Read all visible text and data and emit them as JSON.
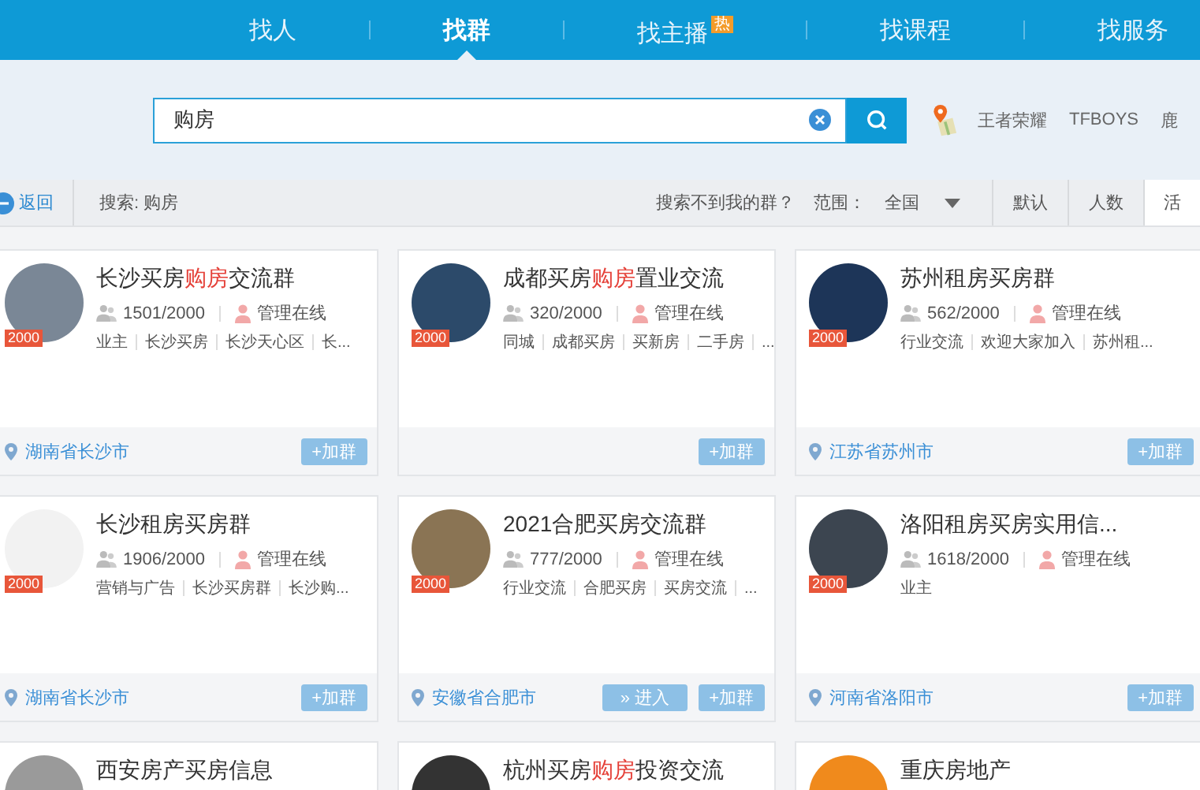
{
  "nav": {
    "tabs": [
      {
        "label": "找人",
        "selected": false
      },
      {
        "label": "找群",
        "selected": true
      },
      {
        "label": "找主播",
        "selected": false,
        "badge": "热"
      },
      {
        "label": "找课程",
        "selected": false
      },
      {
        "label": "找服务",
        "selected": false
      }
    ]
  },
  "search": {
    "value": "购房",
    "hot_keywords": [
      "王者荣耀",
      "TFBOYS",
      "鹿"
    ]
  },
  "filter_bar": {
    "back": "返回",
    "query": "搜索: 购房",
    "help_link": "搜索不到我的群？",
    "range_label": "范围：",
    "range_value": "全国",
    "sort_tabs": [
      {
        "label": "默认",
        "selected": false
      },
      {
        "label": "人数",
        "selected": false
      },
      {
        "label": "活",
        "selected": true
      }
    ]
  },
  "groups": [
    {
      "title": [
        {
          "text": "长沙买房",
          "highlight": false
        },
        {
          "text": "购房",
          "highlight": true
        },
        {
          "text": "交流群",
          "highlight": false
        }
      ],
      "badge": "2000",
      "members": "1501/2000",
      "admin": "管理在线",
      "tags": [
        "业主",
        "长沙买房",
        "长沙天心区",
        "长..."
      ],
      "location": "湖南省长沙市",
      "buttons": [
        {
          "kind": "join",
          "label": "+加群"
        }
      ]
    },
    {
      "title": [
        {
          "text": "成都买房",
          "highlight": false
        },
        {
          "text": "购房",
          "highlight": true
        },
        {
          "text": "置业交流",
          "highlight": false
        }
      ],
      "badge": "2000",
      "members": "320/2000",
      "admin": "管理在线",
      "tags": [
        "同城",
        "成都买房",
        "买新房",
        "二手房",
        "..."
      ],
      "buttons": [
        {
          "kind": "join",
          "label": "+加群"
        }
      ]
    },
    {
      "title": [
        {
          "text": "苏州租房买房群",
          "highlight": false
        }
      ],
      "badge": "2000",
      "members": "562/2000",
      "admin": "管理在线",
      "tags": [
        "行业交流",
        "欢迎大家加入",
        "苏州租..."
      ],
      "location": "江苏省苏州市",
      "buttons": [
        {
          "kind": "join",
          "label": "+加群"
        }
      ]
    },
    {
      "title": [
        {
          "text": "长沙租房买房群",
          "highlight": false
        }
      ],
      "badge": "2000",
      "members": "1906/2000",
      "admin": "管理在线",
      "tags": [
        "营销与广告",
        "长沙买房群",
        "长沙购..."
      ],
      "location": "湖南省长沙市",
      "buttons": [
        {
          "kind": "join",
          "label": "+加群"
        }
      ]
    },
    {
      "title": [
        {
          "text": "2021合肥买房交流群",
          "highlight": false
        }
      ],
      "badge": "2000",
      "members": "777/2000",
      "admin": "管理在线",
      "tags": [
        "行业交流",
        "合肥买房",
        "买房交流",
        "..."
      ],
      "location": "安徽省合肥市",
      "buttons": [
        {
          "kind": "enter",
          "label": "» 进入"
        },
        {
          "kind": "join",
          "label": "+加群"
        }
      ]
    },
    {
      "title": [
        {
          "text": "洛阳租房买房实用信...",
          "highlight": false
        }
      ],
      "badge": "2000",
      "members": "1618/2000",
      "admin": "管理在线",
      "tags": [
        "业主"
      ],
      "location": "河南省洛阳市",
      "buttons": [
        {
          "kind": "join",
          "label": "+加群"
        }
      ]
    },
    {
      "title": [
        {
          "text": "西安房产买房信息",
          "highlight": false
        }
      ]
    },
    {
      "title": [
        {
          "text": "杭州买房",
          "highlight": false
        },
        {
          "text": "购房",
          "highlight": true
        },
        {
          "text": "投资交流",
          "highlight": false
        }
      ]
    },
    {
      "title": [
        {
          "text": "重庆房地产",
          "highlight": false
        }
      ]
    }
  ]
}
